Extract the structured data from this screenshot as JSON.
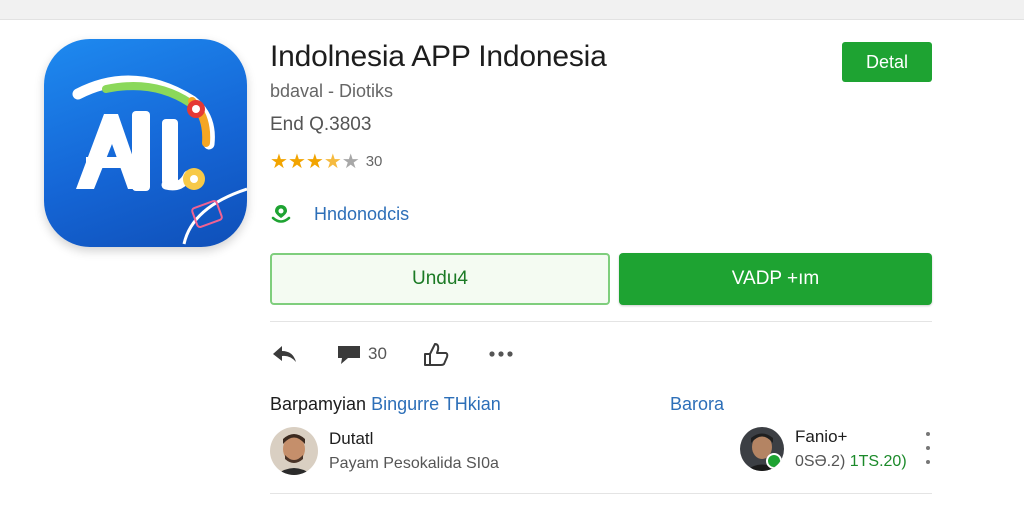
{
  "app": {
    "title": "Indolnesia APP Indonesia",
    "developer": "bdaval - Diotiks",
    "meta": "End Q.3803",
    "rating": {
      "stars": 3.5,
      "max": 5,
      "count": "30"
    },
    "category": "Hndonodcis",
    "icon_letters": "AI"
  },
  "buttons": {
    "detail": "Detal",
    "download": "Undu4",
    "install": "VADP +ım"
  },
  "actions": {
    "comment_count": "30"
  },
  "reviews_section": {
    "title": "Barpamyian",
    "title_accent": "Bingurre THkian",
    "link": "Barora"
  },
  "reviews": [
    {
      "name": "Dutatl",
      "text": "Payam Pesokalida SI0a"
    },
    {
      "name": "Fanio+",
      "text_prefix": "0SƏ.2)",
      "text_highlight": "1TS.20)"
    }
  ],
  "colors": {
    "accent_green": "#1ea332",
    "link_blue": "#2d6fb8",
    "star": "#f2a400",
    "icon_blue": "#1566d6"
  },
  "icons": [
    "back-arrow-icon",
    "comment-icon",
    "thumb-icon",
    "more-dots-icon",
    "location-pin-icon",
    "more-vertical-icon",
    "star-icon"
  ]
}
